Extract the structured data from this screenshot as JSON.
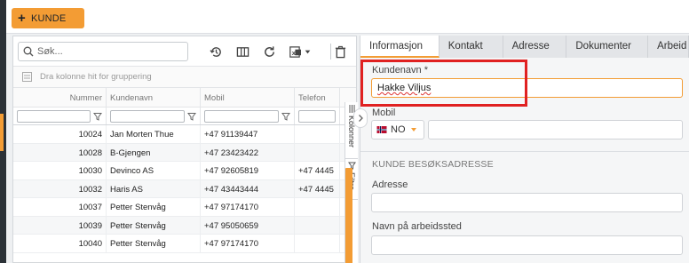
{
  "toolbar": {
    "new_button_label": "KUNDE",
    "new_button_icon": "plus"
  },
  "grid": {
    "search_placeholder": "Søk...",
    "group_hint": "Dra kolonne hit for gruppering",
    "columns": [
      "Nummer",
      "Kundenavn",
      "Mobil",
      "Telefon"
    ],
    "rows": [
      [
        "10024",
        "Jan Morten Thue",
        "+47 91139447",
        ""
      ],
      [
        "10028",
        "B-Gjengen",
        "+47 23423422",
        ""
      ],
      [
        "10030",
        "Devinco AS",
        "+47 92605819",
        "+47 4445"
      ],
      [
        "10032",
        "Haris AS",
        "+47 43443444",
        "+47 4445"
      ],
      [
        "10037",
        "Petter Stenvåg",
        "+47 97174170",
        ""
      ],
      [
        "10039",
        "Petter Stenvåg",
        "+47 95050659",
        ""
      ],
      [
        "10040",
        "Petter Stenvåg",
        "+47 97174170",
        ""
      ]
    ],
    "side_tabs": {
      "columns": "Kolonner",
      "filters": "Filtre"
    }
  },
  "detail": {
    "tabs": [
      "Informasjon",
      "Kontakt",
      "Adresse",
      "Dokumenter",
      "Arbeid"
    ],
    "active_tab": "Informasjon",
    "customer_name_label": "Kundenavn *",
    "customer_name_value": "Hakke Viljus",
    "mobile_label": "Mobil",
    "country_code": "NO",
    "section_title": "KUNDE BESØKSADRESSE",
    "address_label": "Adresse",
    "workplace_label": "Navn på arbeidssted"
  },
  "colors": {
    "accent": "#f39c34",
    "highlight": "#e02121",
    "sidebar": "#2b3137"
  }
}
